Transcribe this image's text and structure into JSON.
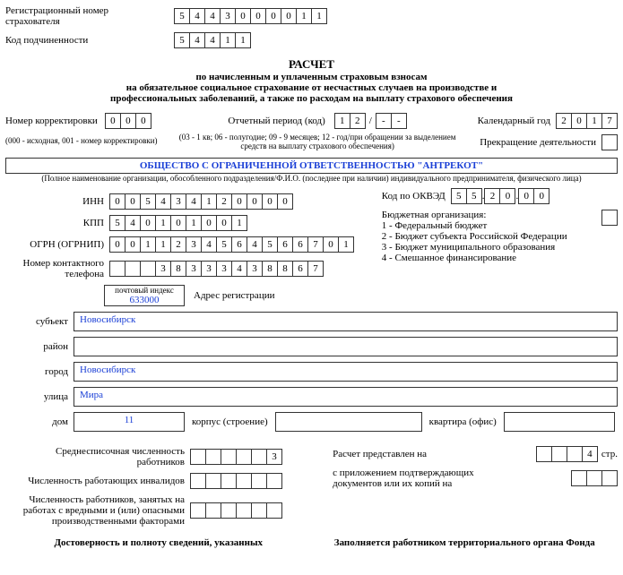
{
  "labels": {
    "reg_num": "Регистрационный номер страхователя",
    "sub_code": "Код подчиненности",
    "title": "РАСЧЕТ",
    "sub1": "по начисленным и уплаченным страховым взносам",
    "sub2": "на обязательное социальное страхование от несчастных случаев на производстве и",
    "sub3": "профессиональных заболеваний, а также по расходам на выплату страхового обеспечения",
    "corr_num": "Номер корректировки",
    "corr_hint": "(000 - исходная, 001 - номер корректировки)",
    "period": "Отчетный период (код)",
    "period_hint": "(03 - 1 кв; 06 - полугодие; 09 - 9 месяцев; 12 - год/при обращении за выделением средств на выплату страхового обеспечения)",
    "year": "Календарный год",
    "cease": "Прекращение деятельности",
    "org_hint": "(Полное наименование организации, обособленного подразделения/Ф.И.О. (последнее при наличии) индивидуального предпринимателя, физического лица)",
    "inn": "ИНН",
    "kpp": "КПП",
    "ogrn": "ОГРН (ОГРНИП)",
    "phone": "Номер контактного телефона",
    "okved": "Код по ОКВЭД",
    "budget_title": "Бюджетная организация:",
    "budget1": "1 - Федеральный бюджет",
    "budget2": "2 - Бюджет субъекта Российской Федерации",
    "budget3": "3 - Бюджет муниципального образования",
    "budget4": "4 - Смешанное финансирование",
    "postcode": "почтовый индекс",
    "addr": "Адрес регистрации",
    "subject": "субъект",
    "district": "район",
    "city": "город",
    "street": "улица",
    "house": "дом",
    "building": "корпус (строение)",
    "flat": "квартира (офис)",
    "headcount": "Среднесписочная численность работников",
    "invalids": "Численность работающих инвалидов",
    "hazard": "Численность работников, занятых на работах с вредными и (или) опасными производственными факторами",
    "raschet_pages": "Расчет представлен на",
    "pages_suffix": "стр.",
    "attach": "с приложением подтверждающих документов или их копий на",
    "footer_left": "Достоверность и полноту сведений, указанных",
    "footer_right": "Заполняется работником территориального органа Фонда"
  },
  "values": {
    "reg_num": [
      "5",
      "4",
      "4",
      "3",
      "0",
      "0",
      "0",
      "0",
      "1",
      "1"
    ],
    "sub_code": [
      "5",
      "4",
      "4",
      "1",
      "1"
    ],
    "corr": [
      "0",
      "0",
      "0"
    ],
    "period_a": [
      "1",
      "2"
    ],
    "period_b": [
      "-",
      "-"
    ],
    "year": [
      "2",
      "0",
      "1",
      "7"
    ],
    "cease": [
      ""
    ],
    "org_name": "ОБЩЕСТВО С ОГРАНИЧЕННОЙ ОТВЕТСТВЕННОСТЬЮ \"АНТРЕКОТ\"",
    "inn": [
      "0",
      "0",
      "5",
      "4",
      "3",
      "4",
      "1",
      "2",
      "0",
      "0",
      "0",
      "0"
    ],
    "kpp": [
      "5",
      "4",
      "0",
      "1",
      "0",
      "1",
      "0",
      "0",
      "1"
    ],
    "ogrn": [
      "0",
      "0",
      "1",
      "1",
      "2",
      "3",
      "4",
      "5",
      "6",
      "4",
      "5",
      "6",
      "6",
      "7",
      "0",
      "1"
    ],
    "phone": [
      "",
      "",
      "",
      "3",
      "8",
      "3",
      "3",
      "3",
      "4",
      "3",
      "8",
      "8",
      "6",
      "7"
    ],
    "okved_a": [
      "5",
      "5"
    ],
    "okved_b": [
      "2",
      "0"
    ],
    "okved_c": [
      "0",
      "0"
    ],
    "budget_box": [
      ""
    ],
    "postcode": "633000",
    "subject": "Новосибирск",
    "district": "",
    "city": "Новосибирск",
    "street": "Мира",
    "house": "11",
    "building": "",
    "flat": "",
    "headcount": [
      "",
      "",
      "",
      "",
      "",
      "3"
    ],
    "invalids": [
      "",
      "",
      "",
      "",
      "",
      ""
    ],
    "hazard": [
      "",
      "",
      "",
      "",
      "",
      ""
    ],
    "pages": [
      "",
      "",
      "",
      "4"
    ],
    "attach": [
      "",
      "",
      ""
    ]
  }
}
